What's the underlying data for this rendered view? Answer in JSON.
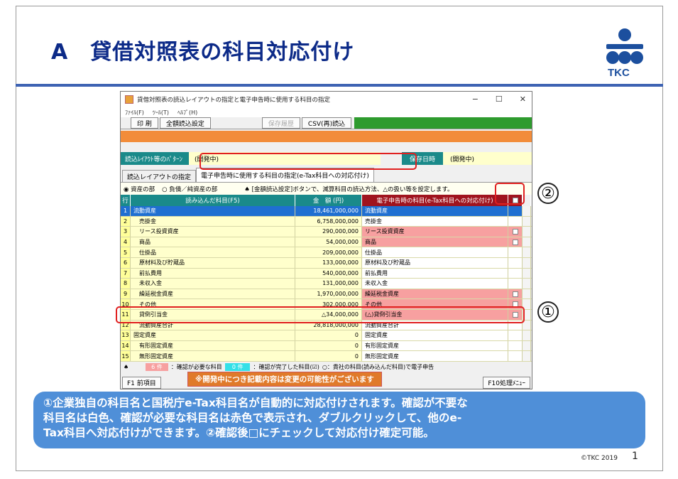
{
  "slide": {
    "title": "A　貸借対照表の科目対応付け",
    "logo_text": "TKC",
    "copyright": "©TKC 2019",
    "page_number": "1",
    "dev_notice": "※開発中につき記載内容は変更の可能性がございます",
    "callout_1": "①",
    "callout_2": "②",
    "caption_lines": [
      "①企業独自の科目名と国税庁e-Tax科目名が自動的に対応付けされます。確認が不要な",
      "科目名は白色、確認が必要な科目名は赤色で表示され、ダブルクリックして、他のe-",
      "Tax科目へ対応付けができます。②確認後□にチェックして対応付け確定可能。"
    ]
  },
  "window": {
    "title": "貸借対照表の読込レイアウトの指定と電子申告時に使用する科目の指定",
    "controls": {
      "minimize": "−",
      "maximize": "☐",
      "close": "✕"
    },
    "menu": [
      "ﾌｧｲﾙ(F)",
      "ﾂｰﾙ(T)",
      "ﾍﾙﾌﾟ(H)"
    ],
    "toolbar": {
      "print": "印 刷",
      "all_settings": "全額読込設定",
      "save_history": "保存履歴",
      "csv_reload": "CSV(再)読込"
    },
    "pattern_label": "読込ﾚｲｱｳﾄ等のﾊﾟﾀｰﾝ",
    "pattern_value": "(開発中)",
    "save_date_label": "保存日時",
    "save_date_value": "(開発中)",
    "tabs": [
      "読込レイアウトの指定",
      "電子申告時に使用する科目の指定(e-Tax科目への対応付け)"
    ],
    "radio_assets": "◉ 資産の部",
    "radio_liabilities": "○ 負債／純資産の部",
    "hint": "♠ [金額読込設定]ボタンで、減算科目の読込方法、△の扱い等を設定します。",
    "grid_headers": {
      "no": "行",
      "name": "読み込んだ科目(F5)",
      "amount": "金　額 (円)",
      "etax": "電子申告時の科目(e-Tax科目への対応付け)"
    },
    "rows": [
      {
        "no": "1",
        "name": "流動資産",
        "amount": "18,461,000,000",
        "etax": "流動資産",
        "red": false,
        "selected": true,
        "check": false
      },
      {
        "no": "2",
        "name": "　売掛金",
        "amount": "6,758,000,000",
        "etax": "売掛金",
        "red": false,
        "selected": false,
        "check": false
      },
      {
        "no": "3",
        "name": "　リース投資資産",
        "amount": "290,000,000",
        "etax": "リース投資資産",
        "red": true,
        "selected": false,
        "check": true
      },
      {
        "no": "4",
        "name": "　商品",
        "amount": "54,000,000",
        "etax": "商品",
        "red": true,
        "selected": false,
        "check": true
      },
      {
        "no": "5",
        "name": "　仕掛品",
        "amount": "209,000,000",
        "etax": "仕掛品",
        "red": false,
        "selected": false,
        "check": false
      },
      {
        "no": "6",
        "name": "　原材料及び貯蔵品",
        "amount": "133,000,000",
        "etax": "原材料及び貯蔵品",
        "red": false,
        "selected": false,
        "check": false
      },
      {
        "no": "7",
        "name": "　前払費用",
        "amount": "540,000,000",
        "etax": "前払費用",
        "red": false,
        "selected": false,
        "check": false
      },
      {
        "no": "8",
        "name": "　未収入金",
        "amount": "131,000,000",
        "etax": "未収入金",
        "red": false,
        "selected": false,
        "check": false
      },
      {
        "no": "9",
        "name": "　繰延税金資産",
        "amount": "1,970,000,000",
        "etax": "繰延税金資産",
        "red": true,
        "selected": false,
        "check": true
      },
      {
        "no": "10",
        "name": "　その他",
        "amount": "302,000,000",
        "etax": "その他",
        "red": true,
        "selected": false,
        "check": true
      },
      {
        "no": "11",
        "name": "　貸倒引当金",
        "amount": "△34,000,000",
        "etax": "(△)貸倒引当金",
        "red": true,
        "selected": false,
        "check": true
      },
      {
        "no": "12",
        "name": "　流動資産合計",
        "amount": "28,818,000,000",
        "etax": "流動資産合計",
        "red": false,
        "selected": false,
        "check": false
      },
      {
        "no": "13",
        "name": "固定資産",
        "amount": "0",
        "etax": "固定資産",
        "red": false,
        "selected": false,
        "check": false
      },
      {
        "no": "14",
        "name": "　有形固定資産",
        "amount": "0",
        "etax": "有形固定資産",
        "red": false,
        "selected": false,
        "check": false
      },
      {
        "no": "15",
        "name": "　無形固定資産",
        "amount": "0",
        "etax": "無形固定資産",
        "red": false,
        "selected": false,
        "check": false
      }
    ],
    "legend": {
      "spade": "♠",
      "red_count": "6 件",
      "red_text": "：確認が必要な科目",
      "cyan_count": "0 件",
      "cyan_text": "：確認が完了した科目(☑)",
      "white_text": "○：貴社の科目(読み込んだ科目)で電子申告"
    },
    "f1": "F1 前項目",
    "f10": "F10処理ﾒﾆｭｰ"
  },
  "colors": {
    "title_blue": "#0c2a88",
    "caption_blue": "#4f8fd8",
    "need_check_red": "#f7a0a0",
    "selected_blue": "#1f6fd1",
    "header_teal": "#1a8a8a",
    "header_maroon": "#a0141e"
  }
}
